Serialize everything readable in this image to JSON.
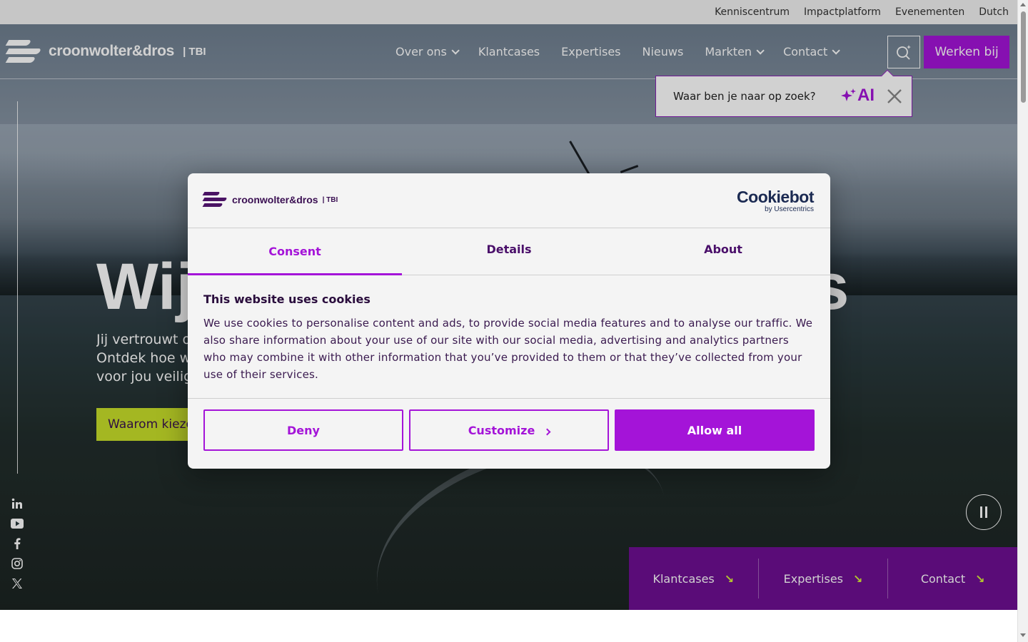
{
  "utility_nav": [
    "Kenniscentrum",
    "Impactplatform",
    "Evenementen",
    "Dutch"
  ],
  "logo": {
    "wordmark": "croonwolter&dros",
    "suffix": "| TBI"
  },
  "main_nav": [
    {
      "label": "Over ons",
      "has_dropdown": true
    },
    {
      "label": "Klantcases",
      "has_dropdown": false
    },
    {
      "label": "Expertises",
      "has_dropdown": false
    },
    {
      "label": "Nieuws",
      "has_dropdown": false
    },
    {
      "label": "Markten",
      "has_dropdown": true
    },
    {
      "label": "Contact",
      "has_dropdown": true
    }
  ],
  "header": {
    "search_icon": "search-ai-icon",
    "cta_label": "Werken bij"
  },
  "search_popup": {
    "placeholder": "Waar ben je naar op zoek?",
    "ai_label": "AI",
    "close_icon": "close-icon"
  },
  "hero": {
    "title_left": "Wij",
    "title_right": "dros",
    "subtitle_lines": [
      "Jij vertrouwt o",
      "Ontdek hoe w",
      "voor jou veilig"
    ],
    "cta_label": "Waarom kieze"
  },
  "social_icons": [
    "linkedin-icon",
    "youtube-icon",
    "facebook-icon",
    "instagram-icon",
    "x-icon"
  ],
  "pause_icon": "pause-icon",
  "quick_links": [
    {
      "label": "Klantcases",
      "icon": "arrow-down-right-icon"
    },
    {
      "label": "Expertises",
      "icon": "arrow-down-right-icon"
    },
    {
      "label": "Contact",
      "icon": "arrow-down-right-icon"
    }
  ],
  "cookie_dialog": {
    "logo_wordmark": "croonwolter&dros",
    "logo_suffix": "| TBI",
    "provider": {
      "name": "Cookiebot",
      "sub": "by Usercentrics"
    },
    "tabs": [
      {
        "label": "Consent",
        "active": true
      },
      {
        "label": "Details",
        "active": false
      },
      {
        "label": "About",
        "active": false
      }
    ],
    "heading": "This website uses cookies",
    "body": "We use cookies to personalise content and ads, to provide social media features and to analyse our traffic. We also share information about your use of our site with our social media, advertising and analytics partners who may combine it with other information that you’ve provided to them or that they’ve collected from your use of their services.",
    "buttons": {
      "deny": "Deny",
      "customize": "Customize",
      "allow_all": "Allow all"
    }
  },
  "colors": {
    "brand_purple": "#a414d8",
    "dark_purple": "#6e0f93",
    "lime": "#c8e02a"
  }
}
